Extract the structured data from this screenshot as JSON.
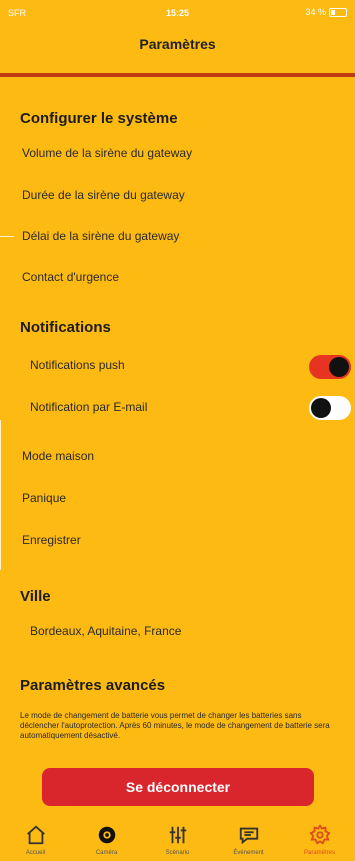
{
  "status_bar": {
    "carrier": "SFR",
    "time": "15:25",
    "battery": "34 %"
  },
  "header": {
    "title": "Paramètres"
  },
  "sections": {
    "system": {
      "title": "Configurer le système",
      "items": [
        "Volume de la sirène du gateway",
        "Durée de la sirène du gateway",
        "Délai de la sirène du gateway",
        "Contact d'urgence"
      ]
    },
    "notifications": {
      "title": "Notifications",
      "push": {
        "label": "Notifications push",
        "enabled": true
      },
      "email": {
        "label": "Notification par E-mail",
        "enabled": false
      },
      "items": [
        "Mode maison",
        "Panique",
        "Enregistrer"
      ]
    },
    "city": {
      "title": "Ville",
      "value": "Bordeaux, Aquitaine, France"
    },
    "advanced": {
      "title": "Paramètres avancés",
      "note": "Le mode de changement de batterie vous permet de changer les batteries sans déclencher l'autoprotection. Après 60 minutes, le mode de changement de batterie sera automatiquement désactivé."
    }
  },
  "logout_label": "Se déconnecter",
  "tabs": [
    {
      "label": "Accueil",
      "icon": "home-icon"
    },
    {
      "label": "Caméra",
      "icon": "camera-icon"
    },
    {
      "label": "Scénario",
      "icon": "sliders-icon"
    },
    {
      "label": "Événement",
      "icon": "message-icon"
    },
    {
      "label": "Paramètres",
      "icon": "gear-icon",
      "active": true
    }
  ],
  "colors": {
    "background": "#FDBA12",
    "accent_red": "#D9262C",
    "header_line": "#C23A15",
    "toggle_on": "#E63322",
    "active_tab": "#E04A1A"
  }
}
